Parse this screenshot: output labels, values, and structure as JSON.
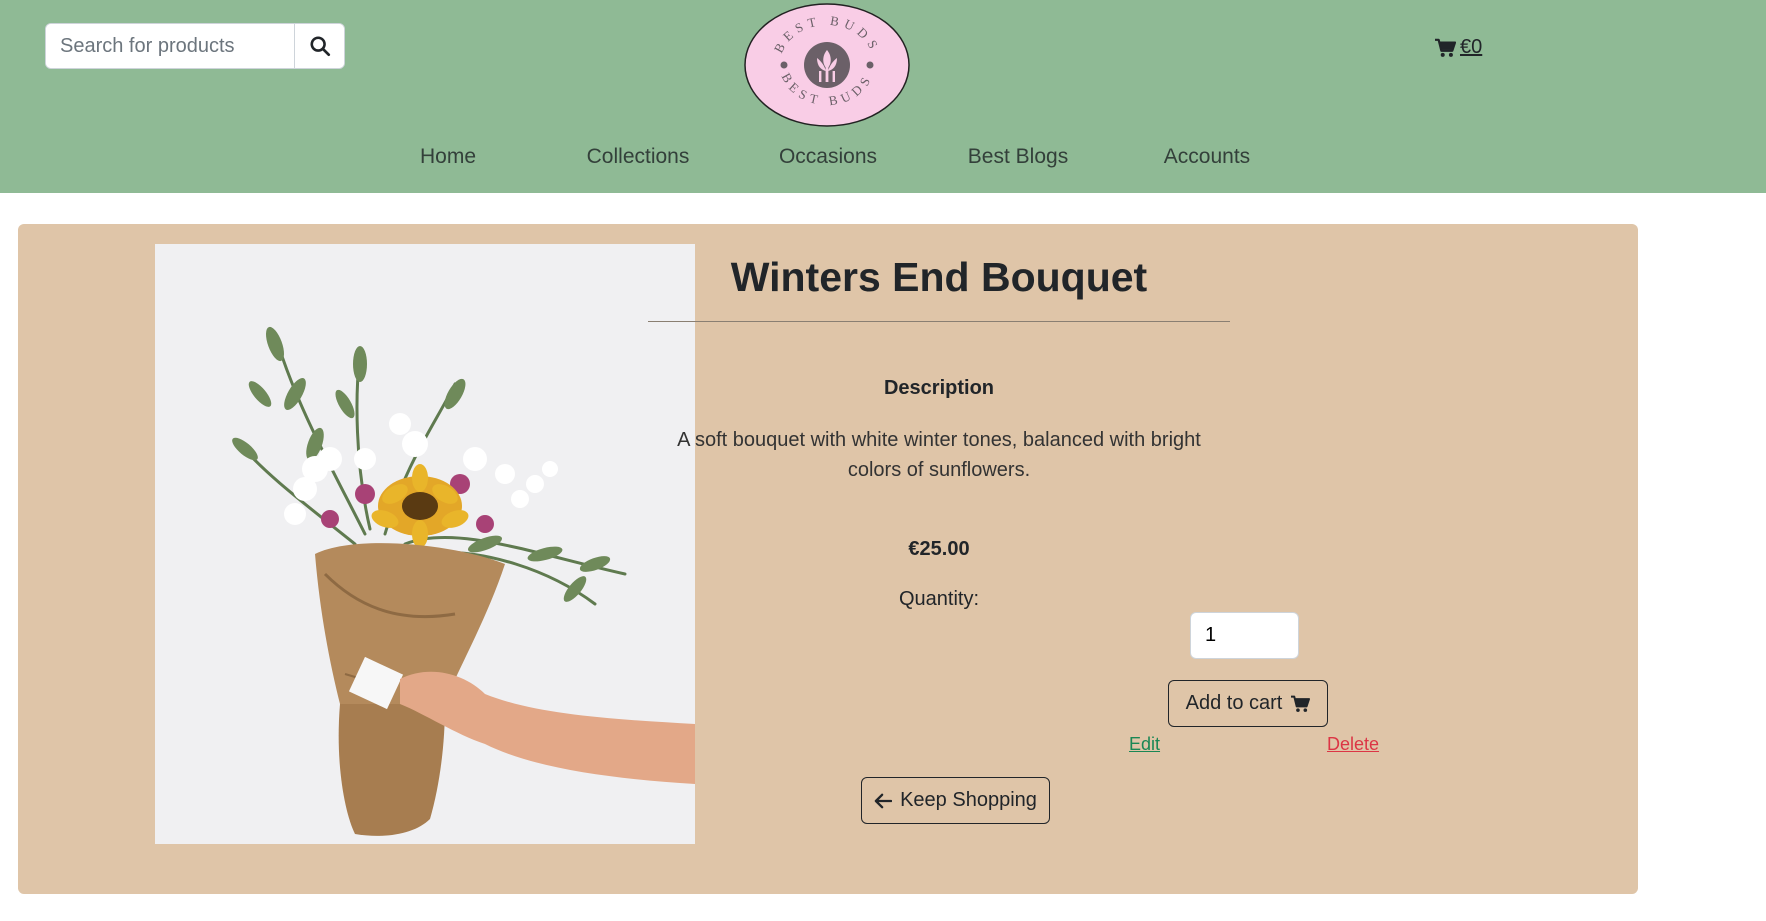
{
  "header": {
    "search": {
      "placeholder": "Search for products",
      "button_icon": "search-icon"
    },
    "logo": {
      "text_top": "BEST BUDS",
      "text_bottom": "BEST BUDS",
      "icon": "tulip-icon"
    },
    "cart": {
      "icon": "cart-icon",
      "total": "€0"
    },
    "nav": [
      {
        "label": "Home"
      },
      {
        "label": "Collections"
      },
      {
        "label": "Occasions"
      },
      {
        "label": "Best Blogs"
      },
      {
        "label": "Accounts"
      }
    ]
  },
  "product": {
    "title": "Winters End Bouquet",
    "description_heading": "Description",
    "description": "A soft bouquet with white winter tones, balanced with bright colors of sunflowers.",
    "price": "€25.00",
    "quantity_label": "Quantity:",
    "quantity_value": "1",
    "add_to_cart_label": "Add to cart",
    "edit_label": "Edit",
    "delete_label": "Delete",
    "keep_shopping_label": "Keep Shopping"
  },
  "colors": {
    "header_bg": "#8fba95",
    "logo_bg": "#f9cde6",
    "card_bg": "#dfc5a8",
    "edit": "#198754",
    "delete": "#dc3545"
  }
}
